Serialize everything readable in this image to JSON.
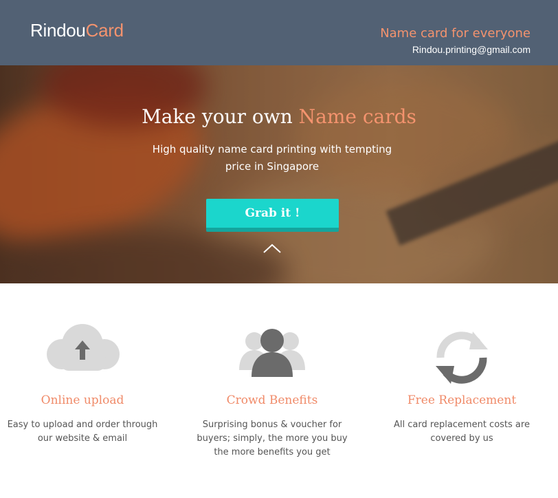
{
  "header": {
    "logo_part1": "Rindou",
    "logo_part2": "Card",
    "tagline": "Name card for everyone",
    "email": "Rindou.printing@gmail.com"
  },
  "hero": {
    "title_part1": "Make your own ",
    "title_highlight": "Name cards",
    "subtitle": "High quality name card printing with tempting price in Singapore",
    "cta_label": "Grab it !",
    "scroll_icon": "chevron-up-icon"
  },
  "features": [
    {
      "icon": "cloud-upload-icon",
      "title": "Online upload",
      "description": "Easy to upload and order through our website & email"
    },
    {
      "icon": "group-users-icon",
      "title": "Crowd Benefits",
      "description": "Surprising bonus & voucher for buyers; simply, the more you buy the more benefits you get"
    },
    {
      "icon": "refresh-icon",
      "title": "Free Replacement",
      "description": "All card replacement costs are covered by us"
    }
  ],
  "colors": {
    "header_bg": "#526174",
    "accent": "#f4936e",
    "cta": "#1bd6cc",
    "icon_gray": "#6b6b6b"
  }
}
